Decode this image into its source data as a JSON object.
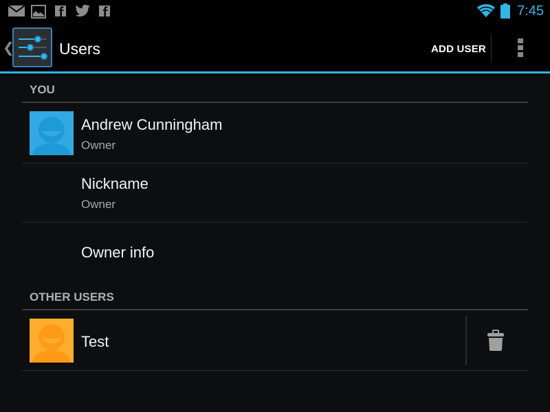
{
  "status_bar": {
    "notifications": [
      "gmail-icon",
      "gallery-icon",
      "facebook-icon",
      "twitter-icon",
      "facebook-icon"
    ],
    "time": "7:45",
    "accent": "#33b5e5"
  },
  "action_bar": {
    "title": "Users",
    "add_user_label": "ADD USER"
  },
  "sections": {
    "you": {
      "header": "YOU",
      "owner": {
        "name": "Andrew Cunningham",
        "role": "Owner",
        "avatar_color": "#33a9e4"
      },
      "nickname": {
        "label": "Nickname",
        "value": "Owner"
      },
      "owner_info": {
        "label": "Owner info"
      }
    },
    "other": {
      "header": "OTHER USERS",
      "users": [
        {
          "name": "Test",
          "avatar_color": "#ffad2f"
        }
      ]
    }
  }
}
